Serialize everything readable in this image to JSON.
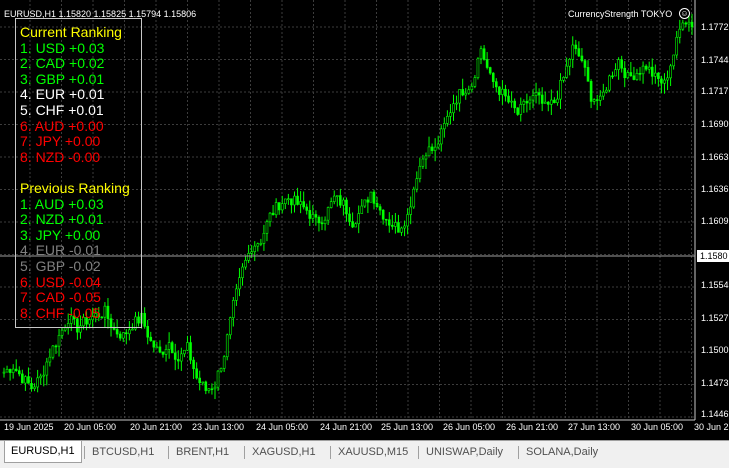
{
  "symbol_info": "EURUSD,H1  1.15820 1.15825 1.15794 1.15806",
  "indicator": {
    "name": "CurrencyStrength TOKYO",
    "close_glyph": "☺"
  },
  "current_ranking": {
    "title": "Current Ranking",
    "items": [
      {
        "text": "1. USD +0.03",
        "color": "#00ff00"
      },
      {
        "text": "2. CAD +0.02",
        "color": "#00ff00"
      },
      {
        "text": "3. GBP +0.01",
        "color": "#00ff00"
      },
      {
        "text": "4. EUR +0.01",
        "color": "#ffffff"
      },
      {
        "text": "5. CHF +0.01",
        "color": "#ffffff"
      },
      {
        "text": "6. AUD +0.00",
        "color": "#ff0000"
      },
      {
        "text": "7. JPY +0.00",
        "color": "#ff0000"
      },
      {
        "text": "8. NZD -0.00",
        "color": "#ff0000"
      }
    ]
  },
  "previous_ranking": {
    "title": "Previous Ranking",
    "items": [
      {
        "text": "1. AUD +0.03",
        "color": "#00ff00"
      },
      {
        "text": "2. NZD +0.01",
        "color": "#00ff00"
      },
      {
        "text": "3. JPY +0.00",
        "color": "#00ff00"
      },
      {
        "text": "4. EUR -0.01",
        "color": "#808080"
      },
      {
        "text": "5. GBP -0.02",
        "color": "#808080"
      },
      {
        "text": "6. USD -0.04",
        "color": "#ff0000"
      },
      {
        "text": "7. CAD -0.05",
        "color": "#ff0000"
      },
      {
        "text": "8. CHF -0.05",
        "color": "#ff0000"
      }
    ]
  },
  "title_color": "#ffff00",
  "price_axis": [
    "1.1772",
    "1.1744",
    "1.1717",
    "1.1690",
    "1.1663",
    "1.1636",
    "1.1609",
    "1.1554",
    "1.1527",
    "1.1500",
    "1.1473",
    "1.1446"
  ],
  "current_price": "1.1580",
  "time_axis": [
    "19 Jun 2025",
    "20 Jun 05:00",
    "20 Jun 21:00",
    "23 Jun 13:00",
    "24 Jun 05:00",
    "24 Jun 21:00",
    "25 Jun 13:00",
    "26 Jun 05:00",
    "26 Jun 21:00",
    "27 Jun 13:00",
    "30 Jun 05:00",
    "30 Jun 2"
  ],
  "tabs": [
    {
      "label": "EURUSD,H1",
      "active": true
    },
    {
      "label": "BTCUSD,H1",
      "active": false
    },
    {
      "label": "BRENT,H1",
      "active": false
    },
    {
      "label": "XAGUSD,H1",
      "active": false
    },
    {
      "label": "XAUUSD,M15",
      "active": false
    },
    {
      "label": "UNISWAP,Daily",
      "active": false
    },
    {
      "label": "SOLANA,Daily",
      "active": false
    }
  ],
  "chart_data": {
    "type": "candlestick",
    "symbol": "EURUSD",
    "timeframe": "H1",
    "ylim": [
      1.1435,
      1.1785
    ],
    "candle_color": "#00ff00",
    "grid": true,
    "close_path": [
      [
        0,
        1.1475
      ],
      [
        3,
        1.148
      ],
      [
        6,
        1.147
      ],
      [
        9,
        1.1462
      ],
      [
        12,
        1.147
      ],
      [
        15,
        1.149
      ],
      [
        18,
        1.1505
      ],
      [
        21,
        1.152
      ],
      [
        24,
        1.1512
      ],
      [
        27,
        1.1518
      ],
      [
        30,
        1.1522
      ],
      [
        33,
        1.1525
      ],
      [
        36,
        1.151
      ],
      [
        39,
        1.1505
      ],
      [
        42,
        1.1515
      ],
      [
        45,
        1.152
      ],
      [
        48,
        1.15
      ],
      [
        51,
        1.149
      ],
      [
        54,
        1.15
      ],
      [
        57,
        1.1485
      ],
      [
        60,
        1.1495
      ],
      [
        63,
        1.147
      ],
      [
        66,
        1.146
      ],
      [
        69,
        1.1465
      ],
      [
        72,
        1.149
      ],
      [
        75,
        1.153
      ],
      [
        78,
        1.156
      ],
      [
        81,
        1.158
      ],
      [
        84,
        1.1585
      ],
      [
        87,
        1.1605
      ],
      [
        90,
        1.1615
      ],
      [
        93,
        1.162
      ],
      [
        96,
        1.1615
      ],
      [
        99,
        1.161
      ],
      [
        102,
        1.16
      ],
      [
        105,
        1.1605
      ],
      [
        108,
        1.162
      ],
      [
        111,
        1.1615
      ],
      [
        114,
        1.16
      ],
      [
        117,
        1.161
      ],
      [
        120,
        1.1625
      ],
      [
        123,
        1.161
      ],
      [
        126,
        1.16
      ],
      [
        129,
        1.1595
      ],
      [
        132,
        1.1605
      ],
      [
        135,
        1.164
      ],
      [
        138,
        1.166
      ],
      [
        141,
        1.166
      ],
      [
        144,
        1.168
      ],
      [
        147,
        1.17
      ],
      [
        150,
        1.171
      ],
      [
        153,
        1.1715
      ],
      [
        156,
        1.1745
      ],
      [
        159,
        1.172
      ],
      [
        162,
        1.171
      ],
      [
        165,
        1.17
      ],
      [
        168,
        1.169
      ],
      [
        171,
        1.17
      ],
      [
        174,
        1.1705
      ],
      [
        177,
        1.1695
      ],
      [
        180,
        1.17
      ],
      [
        183,
        1.172
      ],
      [
        186,
        1.1745
      ],
      [
        189,
        1.1735
      ],
      [
        192,
        1.1705
      ],
      [
        195,
        1.17
      ],
      [
        198,
        1.172
      ],
      [
        201,
        1.1735
      ],
      [
        204,
        1.172
      ],
      [
        207,
        1.1725
      ],
      [
        210,
        1.173
      ],
      [
        213,
        1.172
      ],
      [
        216,
        1.1715
      ],
      [
        219,
        1.174
      ],
      [
        222,
        1.177
      ],
      [
        225,
        1.1765
      ]
    ]
  }
}
